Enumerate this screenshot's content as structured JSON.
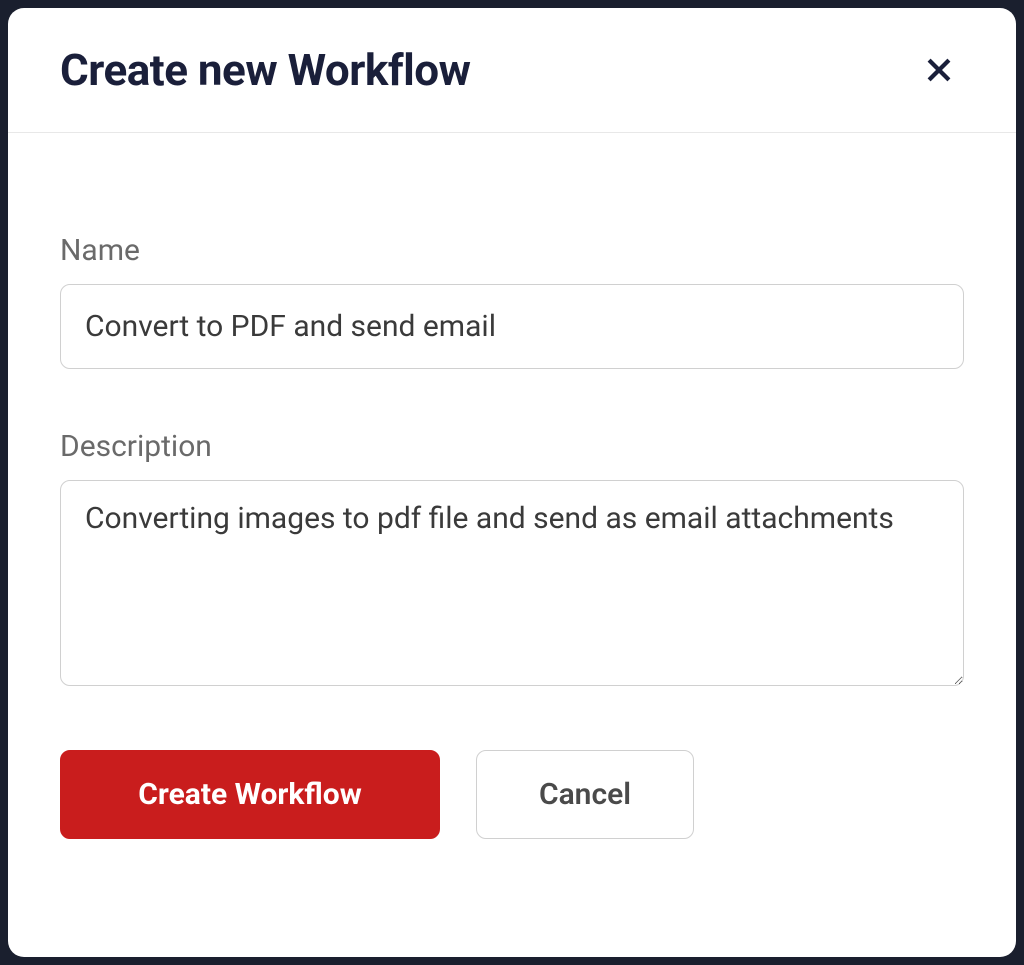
{
  "modal": {
    "title": "Create new Workflow",
    "close_icon": "close"
  },
  "form": {
    "name": {
      "label": "Name",
      "value": "Convert to PDF and send email"
    },
    "description": {
      "label": "Description",
      "value": "Converting images to pdf file and send as email attachments"
    }
  },
  "buttons": {
    "primary": "Create Workflow",
    "secondary": "Cancel"
  }
}
